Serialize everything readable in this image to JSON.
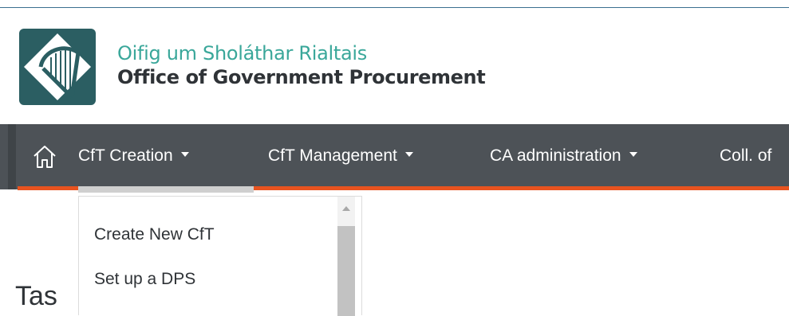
{
  "brand": {
    "name_irish": "Oifig um Sholáthar Rialtais",
    "name_english": "Office of Government Procurement"
  },
  "navbar": {
    "home_icon": "home-icon",
    "items": [
      {
        "label": "CfT Creation",
        "has_caret": true
      },
      {
        "label": "CfT Management",
        "has_caret": true
      },
      {
        "label": "CA administration",
        "has_caret": true
      },
      {
        "label": "Coll. of",
        "has_caret": false
      }
    ]
  },
  "dropdown": {
    "items": [
      {
        "label": "Create New CfT"
      },
      {
        "label": "Set up a DPS"
      }
    ]
  },
  "page": {
    "heading": "Tas"
  },
  "colors": {
    "navbar_bg": "#4d5257",
    "accent": "#e8531f",
    "logo_bg": "#2b5e62",
    "brand_teal": "#3aa79a"
  }
}
